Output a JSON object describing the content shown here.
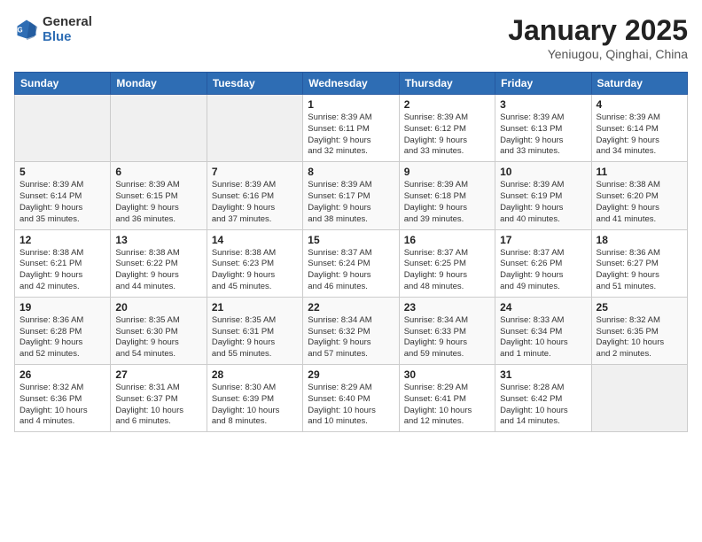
{
  "logo": {
    "general": "General",
    "blue": "Blue"
  },
  "title": "January 2025",
  "subtitle": "Yeniugou, Qinghai, China",
  "days_of_week": [
    "Sunday",
    "Monday",
    "Tuesday",
    "Wednesday",
    "Thursday",
    "Friday",
    "Saturday"
  ],
  "weeks": [
    [
      {
        "day": "",
        "info": ""
      },
      {
        "day": "",
        "info": ""
      },
      {
        "day": "",
        "info": ""
      },
      {
        "day": "1",
        "info": "Sunrise: 8:39 AM\nSunset: 6:11 PM\nDaylight: 9 hours\nand 32 minutes."
      },
      {
        "day": "2",
        "info": "Sunrise: 8:39 AM\nSunset: 6:12 PM\nDaylight: 9 hours\nand 33 minutes."
      },
      {
        "day": "3",
        "info": "Sunrise: 8:39 AM\nSunset: 6:13 PM\nDaylight: 9 hours\nand 33 minutes."
      },
      {
        "day": "4",
        "info": "Sunrise: 8:39 AM\nSunset: 6:14 PM\nDaylight: 9 hours\nand 34 minutes."
      }
    ],
    [
      {
        "day": "5",
        "info": "Sunrise: 8:39 AM\nSunset: 6:14 PM\nDaylight: 9 hours\nand 35 minutes."
      },
      {
        "day": "6",
        "info": "Sunrise: 8:39 AM\nSunset: 6:15 PM\nDaylight: 9 hours\nand 36 minutes."
      },
      {
        "day": "7",
        "info": "Sunrise: 8:39 AM\nSunset: 6:16 PM\nDaylight: 9 hours\nand 37 minutes."
      },
      {
        "day": "8",
        "info": "Sunrise: 8:39 AM\nSunset: 6:17 PM\nDaylight: 9 hours\nand 38 minutes."
      },
      {
        "day": "9",
        "info": "Sunrise: 8:39 AM\nSunset: 6:18 PM\nDaylight: 9 hours\nand 39 minutes."
      },
      {
        "day": "10",
        "info": "Sunrise: 8:39 AM\nSunset: 6:19 PM\nDaylight: 9 hours\nand 40 minutes."
      },
      {
        "day": "11",
        "info": "Sunrise: 8:38 AM\nSunset: 6:20 PM\nDaylight: 9 hours\nand 41 minutes."
      }
    ],
    [
      {
        "day": "12",
        "info": "Sunrise: 8:38 AM\nSunset: 6:21 PM\nDaylight: 9 hours\nand 42 minutes."
      },
      {
        "day": "13",
        "info": "Sunrise: 8:38 AM\nSunset: 6:22 PM\nDaylight: 9 hours\nand 44 minutes."
      },
      {
        "day": "14",
        "info": "Sunrise: 8:38 AM\nSunset: 6:23 PM\nDaylight: 9 hours\nand 45 minutes."
      },
      {
        "day": "15",
        "info": "Sunrise: 8:37 AM\nSunset: 6:24 PM\nDaylight: 9 hours\nand 46 minutes."
      },
      {
        "day": "16",
        "info": "Sunrise: 8:37 AM\nSunset: 6:25 PM\nDaylight: 9 hours\nand 48 minutes."
      },
      {
        "day": "17",
        "info": "Sunrise: 8:37 AM\nSunset: 6:26 PM\nDaylight: 9 hours\nand 49 minutes."
      },
      {
        "day": "18",
        "info": "Sunrise: 8:36 AM\nSunset: 6:27 PM\nDaylight: 9 hours\nand 51 minutes."
      }
    ],
    [
      {
        "day": "19",
        "info": "Sunrise: 8:36 AM\nSunset: 6:28 PM\nDaylight: 9 hours\nand 52 minutes."
      },
      {
        "day": "20",
        "info": "Sunrise: 8:35 AM\nSunset: 6:30 PM\nDaylight: 9 hours\nand 54 minutes."
      },
      {
        "day": "21",
        "info": "Sunrise: 8:35 AM\nSunset: 6:31 PM\nDaylight: 9 hours\nand 55 minutes."
      },
      {
        "day": "22",
        "info": "Sunrise: 8:34 AM\nSunset: 6:32 PM\nDaylight: 9 hours\nand 57 minutes."
      },
      {
        "day": "23",
        "info": "Sunrise: 8:34 AM\nSunset: 6:33 PM\nDaylight: 9 hours\nand 59 minutes."
      },
      {
        "day": "24",
        "info": "Sunrise: 8:33 AM\nSunset: 6:34 PM\nDaylight: 10 hours\nand 1 minute."
      },
      {
        "day": "25",
        "info": "Sunrise: 8:32 AM\nSunset: 6:35 PM\nDaylight: 10 hours\nand 2 minutes."
      }
    ],
    [
      {
        "day": "26",
        "info": "Sunrise: 8:32 AM\nSunset: 6:36 PM\nDaylight: 10 hours\nand 4 minutes."
      },
      {
        "day": "27",
        "info": "Sunrise: 8:31 AM\nSunset: 6:37 PM\nDaylight: 10 hours\nand 6 minutes."
      },
      {
        "day": "28",
        "info": "Sunrise: 8:30 AM\nSunset: 6:39 PM\nDaylight: 10 hours\nand 8 minutes."
      },
      {
        "day": "29",
        "info": "Sunrise: 8:29 AM\nSunset: 6:40 PM\nDaylight: 10 hours\nand 10 minutes."
      },
      {
        "day": "30",
        "info": "Sunrise: 8:29 AM\nSunset: 6:41 PM\nDaylight: 10 hours\nand 12 minutes."
      },
      {
        "day": "31",
        "info": "Sunrise: 8:28 AM\nSunset: 6:42 PM\nDaylight: 10 hours\nand 14 minutes."
      },
      {
        "day": "",
        "info": ""
      }
    ]
  ]
}
